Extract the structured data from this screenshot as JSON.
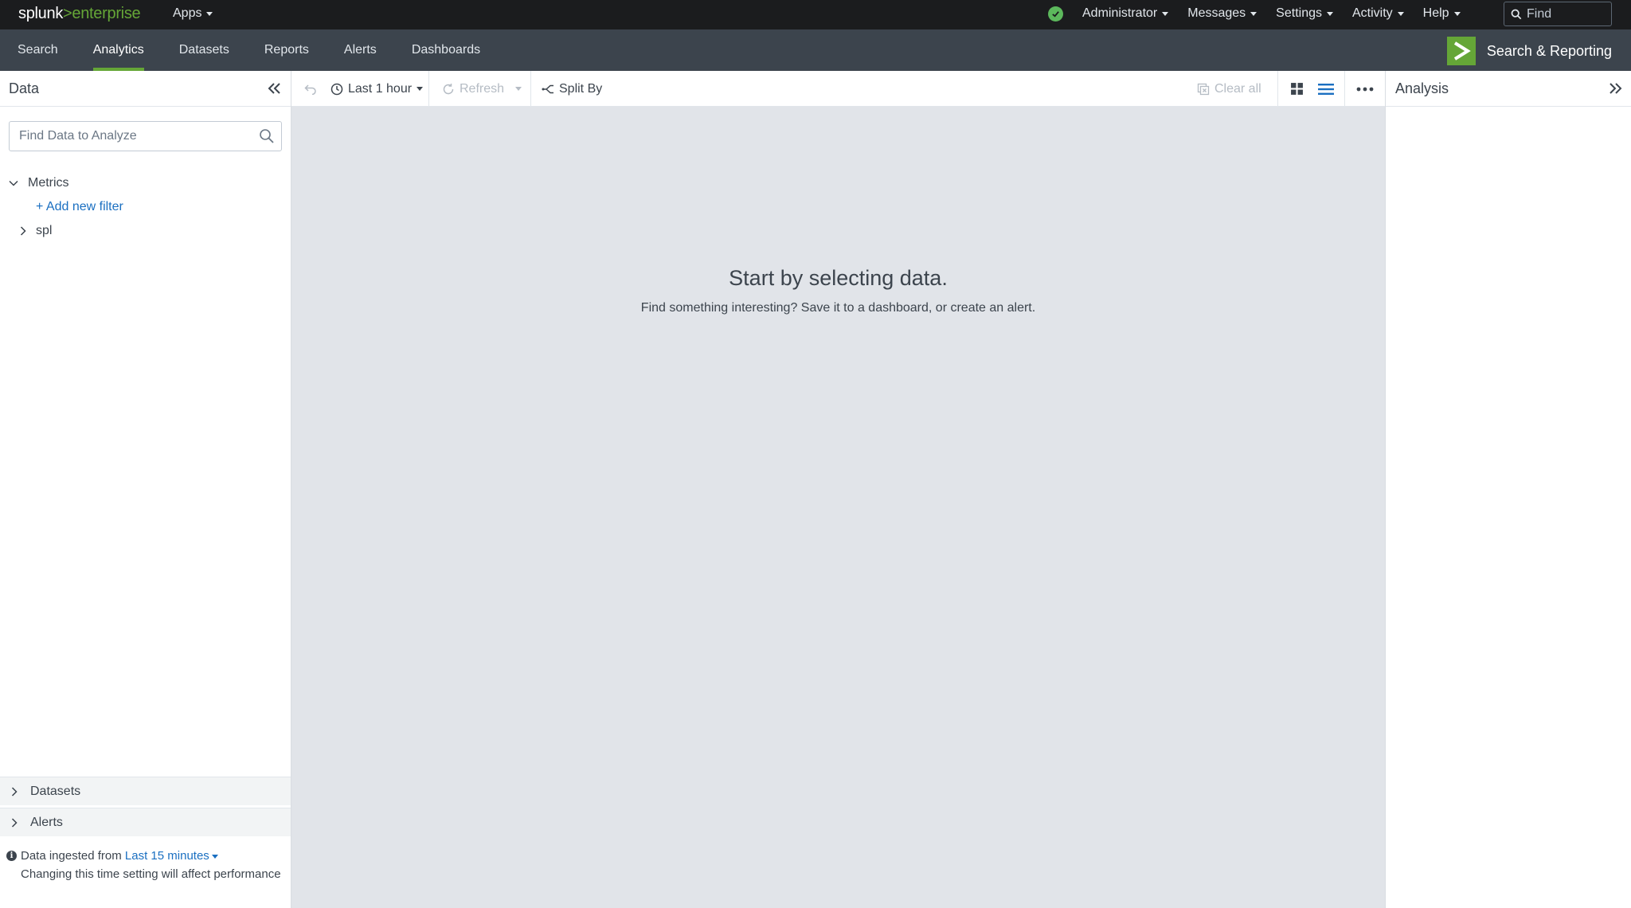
{
  "topbar": {
    "logo_main": "splunk",
    "logo_sep": ">",
    "logo_product": "enterprise",
    "apps_label": "Apps",
    "menus": [
      "Administrator",
      "Messages",
      "Settings",
      "Activity",
      "Help"
    ],
    "find_placeholder": "Find"
  },
  "appbar": {
    "tabs": [
      "Search",
      "Analytics",
      "Datasets",
      "Reports",
      "Alerts",
      "Dashboards"
    ],
    "active_tab": "Analytics",
    "app_title": "Search & Reporting"
  },
  "left_panel": {
    "title": "Data",
    "search_placeholder": "Find Data to Analyze",
    "tree": {
      "metrics_label": "Metrics",
      "add_filter_label": "+ Add new filter",
      "child_label": "spl"
    },
    "sections": [
      "Datasets",
      "Alerts"
    ],
    "ingest": {
      "prefix": "Data ingested from",
      "range": "Last 15 minutes",
      "note": "Changing this time setting will affect performance"
    }
  },
  "toolbar": {
    "time_range": "Last 1 hour",
    "refresh_label": "Refresh",
    "split_by_label": "Split By",
    "clear_all_label": "Clear all"
  },
  "canvas": {
    "empty_title": "Start by selecting data.",
    "empty_subtitle": "Find something interesting? Save it to a dashboard, or create an alert."
  },
  "right_panel": {
    "title": "Analysis"
  },
  "colors": {
    "accent_green": "#65a637",
    "link_blue": "#1a6fc1",
    "topbar_bg": "#1b1c1e",
    "appbar_bg": "#3c444d",
    "canvas_bg": "#e1e4e9"
  }
}
